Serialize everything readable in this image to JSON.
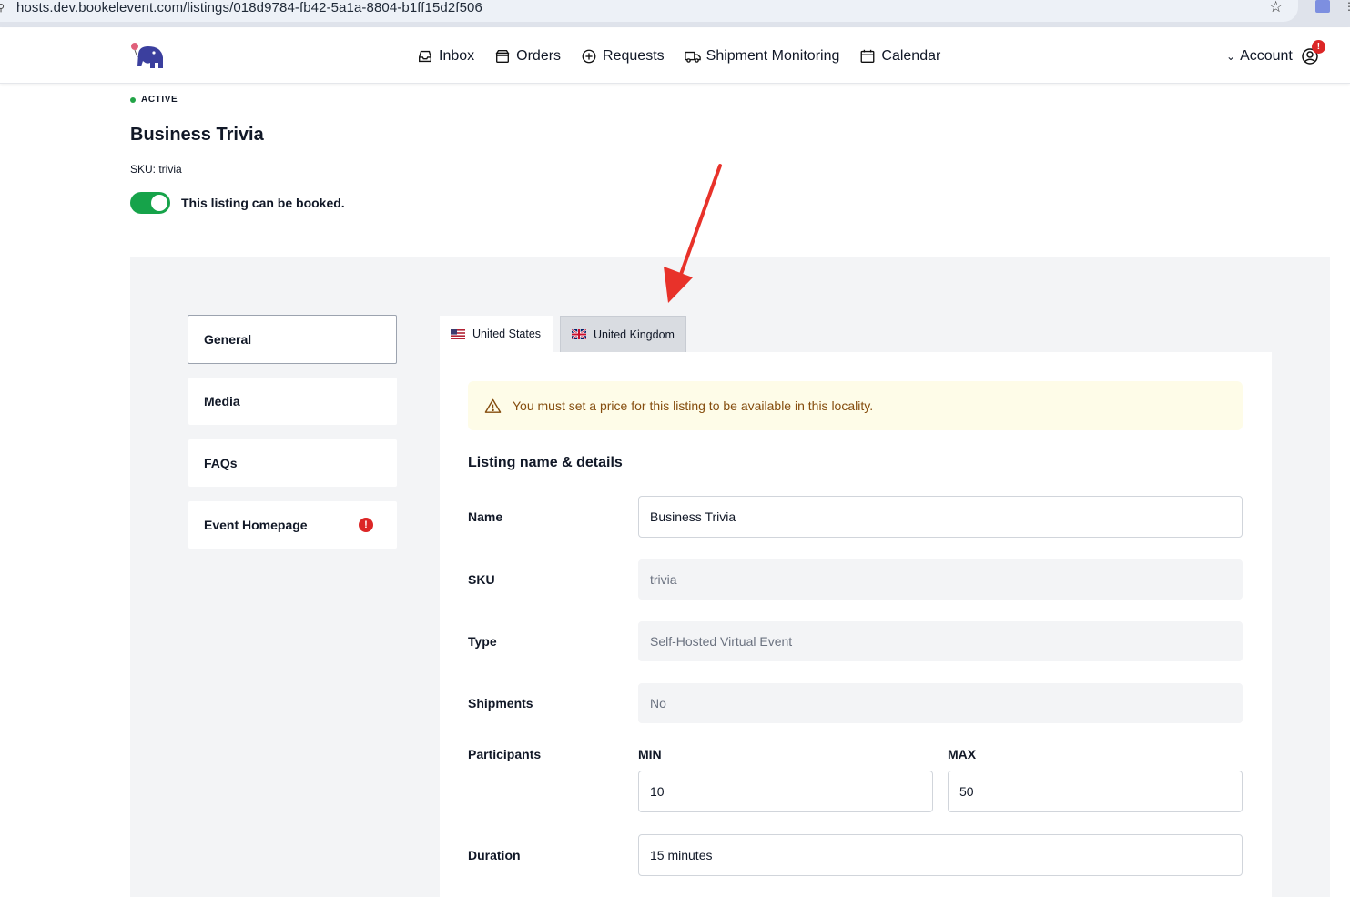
{
  "browser": {
    "url": "hosts.dev.bookelevent.com/listings/018d9784-fb42-5a1a-8804-b1ff15d2f506"
  },
  "header": {
    "nav": [
      {
        "label": "Inbox",
        "icon": "inbox-icon"
      },
      {
        "label": "Orders",
        "icon": "orders-icon"
      },
      {
        "label": "Requests",
        "icon": "plus-circle-icon"
      },
      {
        "label": "Shipment Monitoring",
        "icon": "truck-icon"
      },
      {
        "label": "Calendar",
        "icon": "calendar-icon"
      }
    ],
    "account_label": "Account",
    "account_alert": "!"
  },
  "listing": {
    "status": "ACTIVE",
    "title": "Business Trivia",
    "sku_line": "SKU: trivia",
    "bookable_label": "This listing can be booked.",
    "bookable": true
  },
  "sidenav": {
    "items": [
      {
        "label": "General",
        "active": true
      },
      {
        "label": "Media"
      },
      {
        "label": "FAQs"
      },
      {
        "label": "Event Homepage",
        "error": "!"
      }
    ]
  },
  "tabs": {
    "us": "United States",
    "uk": "United Kingdom",
    "active": "United Kingdom"
  },
  "warning": "You must set a price for this listing to be available in this locality.",
  "form": {
    "section_title": "Listing name & details",
    "name": {
      "label": "Name",
      "value": "Business Trivia"
    },
    "sku": {
      "label": "SKU",
      "value": "trivia"
    },
    "type": {
      "label": "Type",
      "value": "Self-Hosted Virtual Event"
    },
    "shipments": {
      "label": "Shipments",
      "value": "No"
    },
    "participants": {
      "label": "Participants",
      "min_label": "MIN",
      "min": "10",
      "max_label": "MAX",
      "max": "50"
    },
    "duration": {
      "label": "Duration",
      "value": "15 minutes"
    }
  },
  "colors": {
    "active_green": "#16a34a",
    "status_dot": "#22a447",
    "alert_red": "#dc2626",
    "warning_bg": "#fefce8",
    "warning_text": "#854d0e",
    "annotation_arrow": "#e8322a"
  }
}
